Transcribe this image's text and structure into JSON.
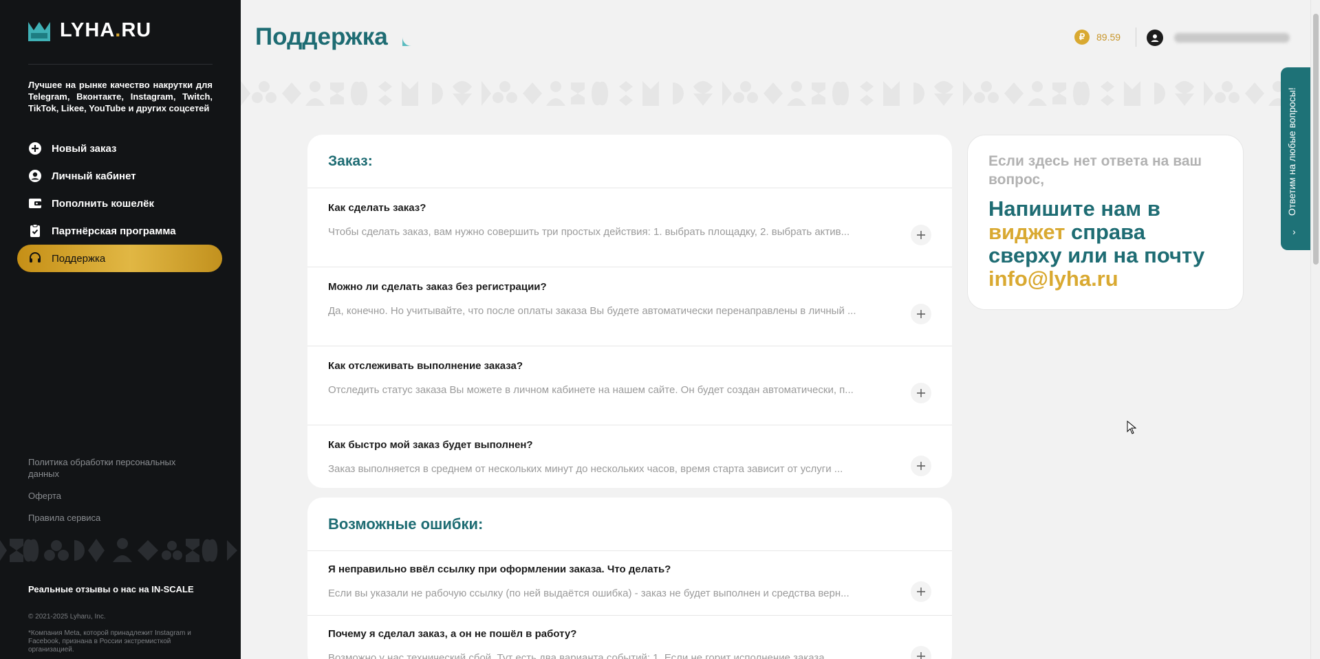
{
  "brand": {
    "name_main": "LYHA",
    "name_dot": ".",
    "name_tld": "RU"
  },
  "tagline": "Лучшее на рынке качество накрутки для Telegram, Вконтакте, Instagram, Twitch, TikTok, Likee, YouTube и других соцсетей",
  "nav": [
    {
      "label": "Новый заказ",
      "icon": "plus-circle-icon"
    },
    {
      "label": "Личный кабинет",
      "icon": "user-circle-icon"
    },
    {
      "label": "Пополнить кошелёк",
      "icon": "wallet-icon"
    },
    {
      "label": "Партнёрская программа",
      "icon": "clipboard-check-icon"
    },
    {
      "label": "Поддержка",
      "icon": "headset-icon",
      "active": true
    }
  ],
  "sidebar_links": [
    "Политика обработки персональных данных",
    "Оферта",
    "Правила сервиса"
  ],
  "reviews_text": "Реальные отзывы о нас на IN-SCALE",
  "copyright": "© 2021-2025 Lyharu, Inc.",
  "meta_note": "*Компания Meta, которой принадлежит Instagram и Facebook, признана в России экстремисткой организацией.",
  "header": {
    "title": "Поддержка",
    "balance_currency": "₽",
    "balance": "89.59"
  },
  "faq_sections": [
    {
      "title": "Заказ:",
      "items": [
        {
          "q": "Как сделать заказ?",
          "a": "Чтобы сделать заказ, вам нужно совершить три простых действия: 1. выбрать площадку, 2. выбрать актив..."
        },
        {
          "q": "Можно ли сделать заказ без регистрации?",
          "a": "Да, конечно. Но учитывайте, что после оплаты заказа Вы будете автоматически перенаправлены в личный ..."
        },
        {
          "q": "Как отслеживать выполнение заказа?",
          "a": "Отследить статус заказа Вы можете в личном кабинете на нашем сайте. Он будет создан автоматически, п..."
        },
        {
          "q": "Как быстро мой заказ будет выполнен?",
          "a": "Заказ выполняется в среднем от нескольких минут до нескольких часов, время старта зависит от услуги ..."
        }
      ]
    },
    {
      "title": "Возможные ошибки:",
      "items": [
        {
          "q": "Я неправильно ввёл ссылку при оформлении заказа. Что делать?",
          "a": "Если вы указали не рабочую ссылку (по ней выдаётся ошибка) - заказ не будет выполнен и средства верн..."
        },
        {
          "q": "Почему я сделал заказ, а он не пошёл в работу?",
          "a": "Возможно у нас технический сбой. Тут есть два варианта событий: 1. Если не горит исполнение заказа..."
        }
      ]
    }
  ],
  "contact": {
    "muted": "Если здесь нет ответа на ваш вопрос,",
    "line1": "Напишите нам в",
    "gold1": "виджет",
    "line2": " справа сверху или на почту",
    "email": "info@lyha.ru"
  },
  "widget_tab": {
    "label": "Ответим на любые вопросы!",
    "chevron": "›"
  },
  "colors": {
    "accent": "#1e6c73",
    "gold": "#d9a931",
    "sidebar_bg": "#121416"
  }
}
